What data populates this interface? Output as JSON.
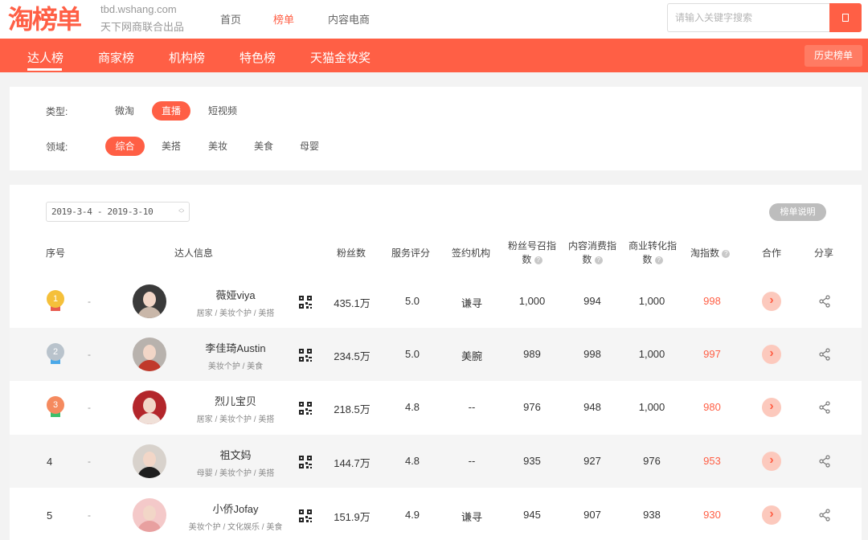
{
  "header": {
    "logo_text": "淘榜单",
    "domain": "tbd.wshang.com",
    "tagline": "天下网商联合出品",
    "nav": [
      "首页",
      "榜单",
      "内容电商"
    ],
    "active_nav": "榜单",
    "search_placeholder": "请输入关键字搜索",
    "search_button_glyph": ""
  },
  "tabs": {
    "items": [
      "达人榜",
      "商家榜",
      "机构榜",
      "特色榜",
      "天猫金妆奖"
    ],
    "active": "达人榜",
    "history_button": "历史榜单"
  },
  "filters": {
    "type_label": "类型:",
    "type_options": [
      "微淘",
      "直播",
      "短视频"
    ],
    "type_selected": "直播",
    "domain_label": "领域:",
    "domain_options": [
      "综合",
      "美搭",
      "美妆",
      "美食",
      "母婴"
    ],
    "domain_selected": "综合"
  },
  "toolbar": {
    "date_range": "2019-3-4 - 2019-3-10",
    "explain_button": "榜单说明"
  },
  "table": {
    "headers": {
      "rank": "序号",
      "info": "达人信息",
      "fans": "粉丝数",
      "service": "服务评分",
      "agency": "签约机构",
      "fan_summon_1": "粉丝号召指",
      "fan_summon_2": "数",
      "content_consume_1": "内容消费指",
      "content_consume_2": "数",
      "commerce_1": "商业转化指",
      "commerce_2": "数",
      "tao_index": "淘指数",
      "coop": "合作",
      "share": "分享"
    },
    "rows": [
      {
        "rank": "1",
        "medal_color": "#f5c03a",
        "ribbon_color": "#e85a4f",
        "change": "-",
        "name": "薇娅viya",
        "tags": "居家 / 美妆个护 / 美搭",
        "fans": "435.1万",
        "service": "5.0",
        "agency": "谦寻",
        "fan_index": "1,000",
        "content_index": "994",
        "commerce_index": "1,000",
        "tao_index": "998"
      },
      {
        "rank": "2",
        "medal_color": "#b9c3cc",
        "ribbon_color": "#4aa8e8",
        "change": "-",
        "name": "李佳琦Austin",
        "tags": "美妆个护 / 美食",
        "fans": "234.5万",
        "service": "5.0",
        "agency": "美腕",
        "fan_index": "989",
        "content_index": "998",
        "commerce_index": "1,000",
        "tao_index": "997"
      },
      {
        "rank": "3",
        "medal_color": "#f58a5f",
        "ribbon_color": "#3cbf6b",
        "change": "-",
        "name": "烈儿宝贝",
        "tags": "居家 / 美妆个护 / 美搭",
        "fans": "218.5万",
        "service": "4.8",
        "agency": "--",
        "fan_index": "976",
        "content_index": "948",
        "commerce_index": "1,000",
        "tao_index": "980"
      },
      {
        "rank": "4",
        "change": "-",
        "name": "祖文妈",
        "tags": "母婴 / 美妆个护 / 美搭",
        "fans": "144.7万",
        "service": "4.8",
        "agency": "--",
        "fan_index": "935",
        "content_index": "927",
        "commerce_index": "976",
        "tao_index": "953"
      },
      {
        "rank": "5",
        "change": "-",
        "name": "小侨Jofay",
        "tags": "美妆个护 / 文化娱乐 / 美食",
        "fans": "151.9万",
        "service": "4.9",
        "agency": "谦寻",
        "fan_index": "945",
        "content_index": "907",
        "commerce_index": "938",
        "tao_index": "930"
      }
    ]
  },
  "colors": {
    "accent": "#ff5f45"
  }
}
